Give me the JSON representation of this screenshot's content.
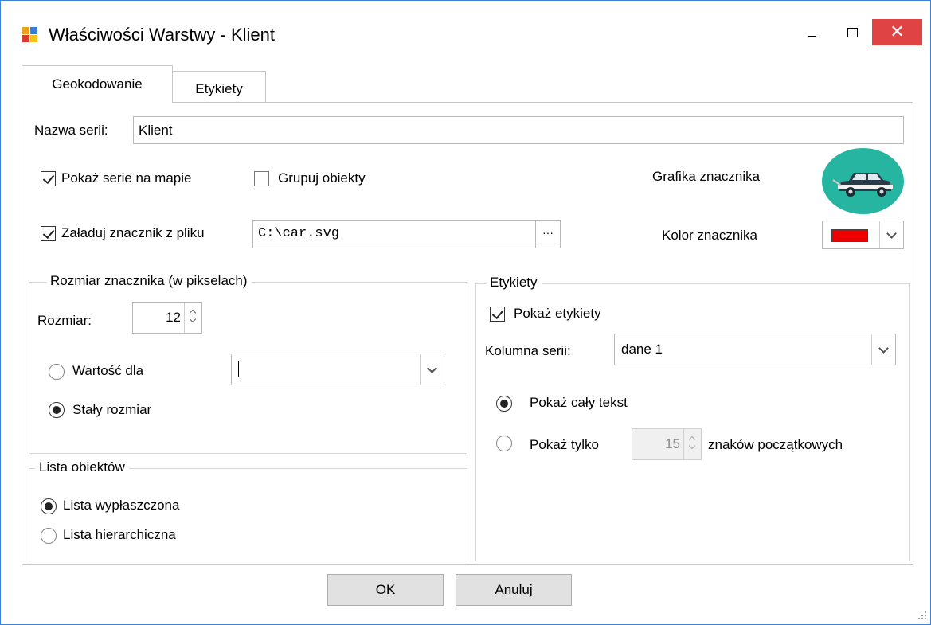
{
  "window": {
    "title": "Właściwości Warstwy - Klient",
    "close_glyph": "✕"
  },
  "tabs": [
    {
      "label": "Geokodowanie",
      "active": true
    },
    {
      "label": "Etykiety",
      "active": false
    }
  ],
  "series": {
    "name_label": "Nazwa serii:",
    "name_value": "Klient",
    "show_on_map_label": "Pokaż serie na mapie",
    "show_on_map_checked": true,
    "group_objects_label": "Grupuj obiekty",
    "group_objects_checked": false,
    "marker_graphic_label": "Grafika znacznika",
    "marker_graphic_icon": "car-icon",
    "load_marker_label": "Załaduj znacznik z pliku",
    "load_marker_checked": true,
    "file_path": "C:\\car.svg",
    "browse_label": "···",
    "marker_color_label": "Kolor znacznika",
    "marker_color": "#ee0000"
  },
  "size_group": {
    "title": "Rozmiar znacznika (w pikselach)",
    "size_label": "Rozmiar:",
    "size_value": "12",
    "value_for_label": "Wartość dla",
    "value_for_selected": false,
    "value_for_dropdown": "",
    "fixed_size_label": "Stały rozmiar",
    "fixed_size_selected": true
  },
  "object_list_group": {
    "title": "Lista obiektów",
    "flat_label": "Lista wypłaszczona",
    "flat_selected": true,
    "hierarchical_label": "Lista hierarchiczna",
    "hierarchical_selected": false
  },
  "labels_group": {
    "title": "Etykiety",
    "show_labels_label": "Pokaż etykiety",
    "show_labels_checked": true,
    "column_label": "Kolumna serii:",
    "column_value": "dane 1",
    "full_text_label": "Pokaż cały tekst",
    "full_text_selected": true,
    "only_label": "Pokaż tylko",
    "only_selected": false,
    "chars_value": "15",
    "chars_suffix": "znaków początkowych"
  },
  "buttons": {
    "ok": "OK",
    "cancel": "Anuluj"
  },
  "colors": {
    "close_red": "#e04343",
    "marker_teal": "#26b5a0",
    "window_border": "#3c82d7"
  }
}
